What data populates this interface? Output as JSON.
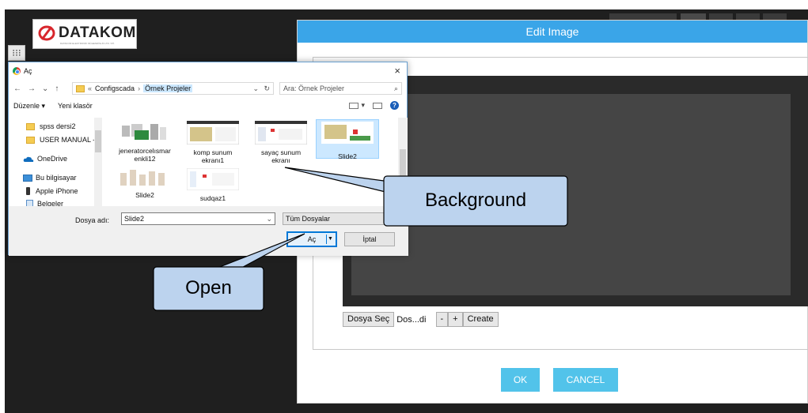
{
  "app": {
    "logo_text": "DATAKOM",
    "logo_subtext": "DATAKOM ELEKTRONİK MÜHENDİSLİK LTD. ŞTİ.",
    "grid_button": "⁝⁝⁝"
  },
  "edit_dialog": {
    "title": "Edit Image",
    "choose_file_button": "Dosya Seç",
    "file_name": "Dos...di",
    "minus_button": "-",
    "plus_button": "+",
    "create_button": "Create",
    "ok_button": "OK",
    "cancel_button": "CANCEL"
  },
  "open_dialog": {
    "title": "Aç",
    "close_glyph": "×",
    "nav_back": "←",
    "nav_forward": "→",
    "nav_recent": "⌄",
    "nav_up": "↑",
    "breadcrumb_prefix": "«",
    "breadcrumb_parent": "Configscada",
    "breadcrumb_sep": "›",
    "breadcrumb_current": "Örnek Projeler",
    "addr_dropdown": "⌄",
    "refresh_glyph": "↻",
    "search_placeholder": "Ara: Örnek Projeler",
    "search_glyph": "⌕",
    "organize_label": "Düzenle ▾",
    "new_folder_label": "Yeni klasör",
    "view_dropdown": "▾",
    "help_glyph": "?",
    "nav_items": [
      {
        "label": "spss dersi2"
      },
      {
        "label": "USER MANUAL -"
      },
      {
        "label": "OneDrive"
      },
      {
        "label": "Bu bilgisayar"
      },
      {
        "label": "Apple iPhone"
      },
      {
        "label": "Belgeler"
      }
    ],
    "files": [
      {
        "name": "jeneratorcelısmar enkli12"
      },
      {
        "name": "komp sunum ekranı1"
      },
      {
        "name": "sayaç sunum ekranı"
      },
      {
        "name": "Slide2"
      },
      {
        "name": "Slide2"
      },
      {
        "name": "sudqaz1"
      }
    ],
    "file_name_label": "Dosya adı:",
    "file_name_value": "Slide2",
    "file_name_dropdown": "⌄",
    "file_type": "Tüm Dosyalar",
    "open_button": "Aç",
    "open_split": "▼",
    "cancel_button": "İptal"
  },
  "callouts": {
    "background": "Background",
    "open": "Open"
  },
  "colors": {
    "accent": "#3aa5e8",
    "button": "#52c3ea",
    "callout_fill": "#bcd3ee",
    "selection": "#cce8ff"
  }
}
